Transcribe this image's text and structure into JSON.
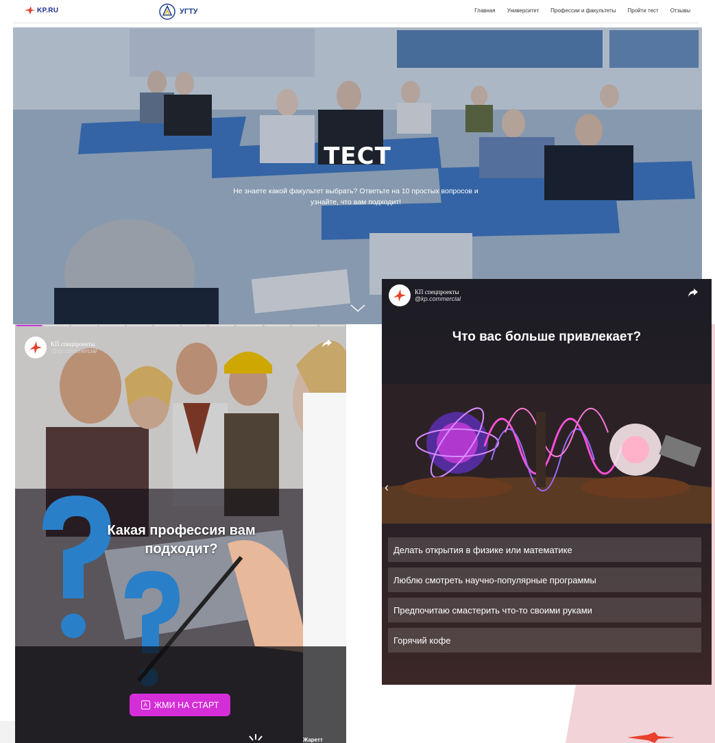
{
  "nav": {
    "kp_logo": "KP.RU",
    "ugtu_logo": "УГТУ",
    "menu": [
      "Главная",
      "Университет",
      "Профессии и факультеты",
      "Пройти тест",
      "Отзывы"
    ]
  },
  "hero": {
    "title": "ТЕСТ",
    "subtitle": "Не знаете какой факультет выбрать? Ответьте на 10 простых вопросов и узнайте, что вам подходит!"
  },
  "story": {
    "author_name": "КП спецпроекты",
    "author_handle": "@kp.commercial",
    "question": "Какая профессия вам подходит?",
    "start_button": "ЖМИ НА СТАРТ",
    "start_button_key": "A",
    "bottom_text": "Жаретт",
    "progress_segments": 12,
    "progress_active": 1
  },
  "quiz": {
    "author_name": "КП спецпроекты",
    "author_handle": "@kp.commercial",
    "question": "Что вас больше привлекает?",
    "answers": [
      "Делать открытия в физике или математике",
      "Люблю смотреть научно-популярные программы",
      "Предпочитаю смастерить что-то своими руками",
      "Горячий кофе"
    ]
  },
  "colors": {
    "accent": "#d52ed8",
    "pink_bg": "#f2d3d8",
    "nav_blue": "#1d3d8f"
  }
}
